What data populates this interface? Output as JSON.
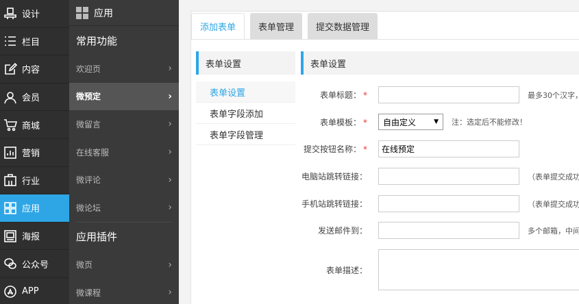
{
  "nav1": {
    "items": [
      {
        "label": "设计",
        "icon": "design-icon"
      },
      {
        "label": "栏目",
        "icon": "list-icon"
      },
      {
        "label": "内容",
        "icon": "edit-icon"
      },
      {
        "label": "会员",
        "icon": "user-icon"
      },
      {
        "label": "商城",
        "icon": "cart-icon"
      },
      {
        "label": "营销",
        "icon": "chart-icon"
      },
      {
        "label": "行业",
        "icon": "industry-icon"
      },
      {
        "label": "应用",
        "icon": "apps-icon"
      },
      {
        "label": "海报",
        "icon": "poster-icon"
      },
      {
        "label": "公众号",
        "icon": "wechat-icon"
      },
      {
        "label": "APP",
        "icon": "appstore-icon"
      }
    ],
    "active_index": 7
  },
  "nav2": {
    "title": "应用",
    "section1": "常用功能",
    "items1": [
      "欢迎页",
      "微预定",
      "微留言",
      "在线客服",
      "微评论",
      "微论坛"
    ],
    "section2": "应用插件",
    "items2": [
      "微页",
      "微课程"
    ],
    "active": "微预定"
  },
  "tabs": [
    "添加表单",
    "表单管理",
    "提交数据管理"
  ],
  "sub": {
    "head": "表单设置",
    "items": [
      "表单设置",
      "表单字段添加",
      "表单字段管理"
    ]
  },
  "form": {
    "head": "表单设置",
    "title_label": "表单标题：",
    "title_hint": "最多30个汉字，",
    "template_label": "表单模板：",
    "template_value": "自由定义",
    "template_hint": "注：选定后不能修改！",
    "submit_label": "提交按钮名称：",
    "submit_value": "在线预定",
    "pc_link_label": "电脑站跳转链接：",
    "pc_link_hint": "（表单提交成功",
    "mobile_link_label": "手机站跳转链接：",
    "mobile_link_hint": "（表单提交成功",
    "email_label": "发送邮件到：",
    "email_hint": "多个邮箱，中间",
    "desc_label": "表单描述："
  },
  "colors": {
    "accent": "#2ea6e6",
    "nav_bg": "#2f2f2f",
    "nav2_bg": "#3a3a3a"
  }
}
